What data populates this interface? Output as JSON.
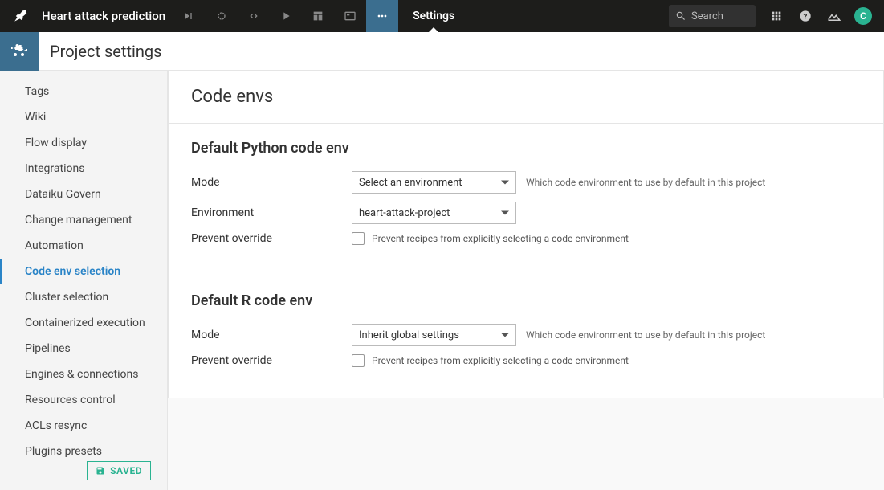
{
  "topbar": {
    "project_title": "Heart attack prediction",
    "nav_label": "Settings",
    "search_placeholder": "Search",
    "avatar_initial": "C"
  },
  "subheader": {
    "title": "Project settings"
  },
  "sidebar": {
    "items": [
      "Tags",
      "Wiki",
      "Flow display",
      "Integrations",
      "Dataiku Govern",
      "Change management",
      "Automation",
      "Code env selection",
      "Cluster selection",
      "Containerized execution",
      "Pipelines",
      "Engines & connections",
      "Resources control",
      "ACLs resync",
      "Plugins presets"
    ],
    "active_index": 7,
    "saved_label": "SAVED"
  },
  "content": {
    "panel_title": "Code envs",
    "sections": [
      {
        "title": "Default Python code env",
        "rows": [
          {
            "label": "Mode",
            "value": "Select an environment",
            "hint": "Which code environment to use by default in this project"
          },
          {
            "label": "Environment",
            "value": "heart-attack-project",
            "hint": ""
          },
          {
            "label": "Prevent override",
            "checkbox": true,
            "checked": false,
            "checkbox_label": "Prevent recipes from explicitly selecting a code environment"
          }
        ]
      },
      {
        "title": "Default R code env",
        "rows": [
          {
            "label": "Mode",
            "value": "Inherit global settings",
            "hint": "Which code environment to use by default in this project"
          },
          {
            "label": "Prevent override",
            "checkbox": true,
            "checked": false,
            "checkbox_label": "Prevent recipes from explicitly selecting a code environment"
          }
        ]
      }
    ]
  }
}
